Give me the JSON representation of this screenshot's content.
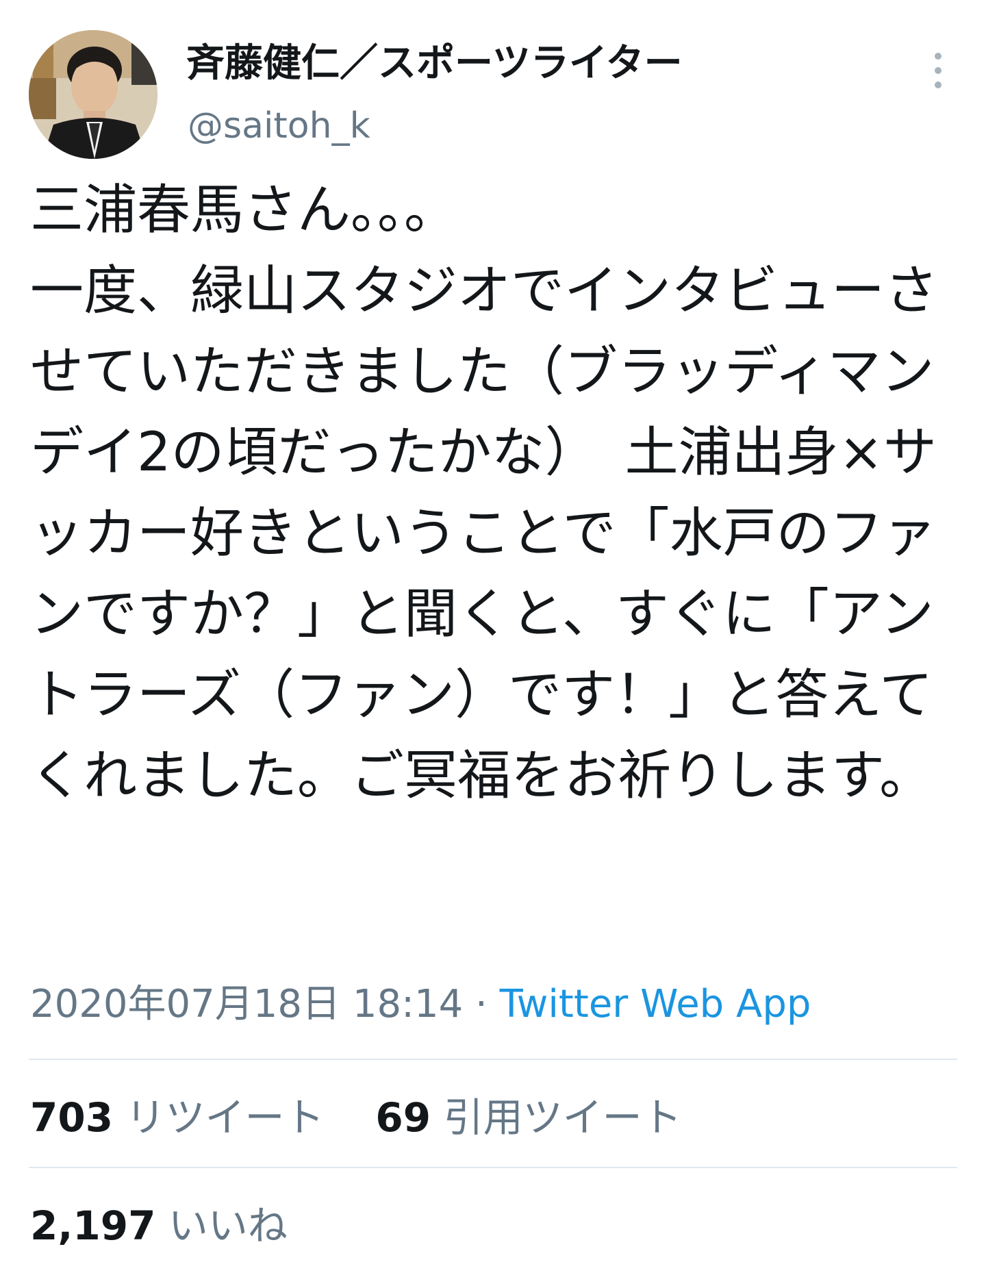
{
  "user": {
    "display_name": "斉藤健仁／スポーツライター",
    "handle": "@saitoh_k"
  },
  "tweet": {
    "text": "三浦春馬さん。。。\n一度、緑山スタジオでインタビューさせていただきました（ブラッディマンデイ2の頃だったかな）　土浦出身×サッカー好きということで「水戸のファンですか？」と聞くと、すぐに「アントラーズ（ファン）です！」と答えてくれました。ご冥福をお祈りします。",
    "timestamp": "2020年07月18日 18:14",
    "separator": " · ",
    "source": "Twitter Web App"
  },
  "stats": {
    "retweets_count": "703",
    "retweets_label": "リツイート",
    "quotes_count": "69",
    "quotes_label": "引用ツイート",
    "likes_count": "2,197",
    "likes_label": "いいね"
  },
  "colors": {
    "text": "#14171a",
    "secondary": "#657786",
    "link": "#1b95e0",
    "divider": "#e1e8ed"
  },
  "icons": {
    "more": "more-vertical-icon"
  }
}
